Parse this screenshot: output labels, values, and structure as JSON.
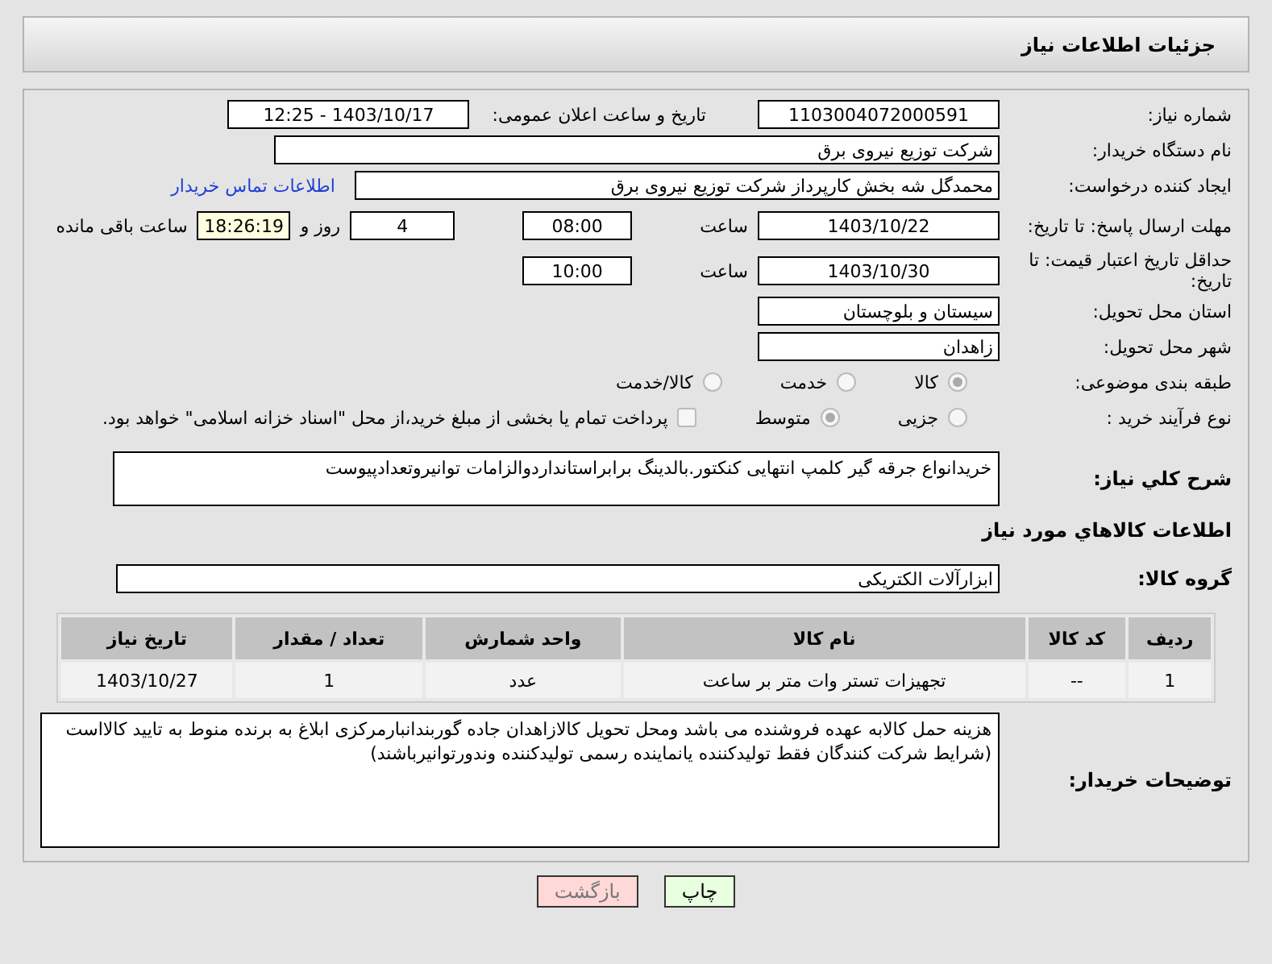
{
  "header": {
    "title": "جزئیات اطلاعات نیاز"
  },
  "need_number": {
    "label": "شماره نیاز:",
    "value": "1103004072000591"
  },
  "announce": {
    "label": "تاریخ و ساعت اعلان عمومی:",
    "value": "1403/10/17 - 12:25"
  },
  "buyer_org": {
    "label": "نام دستگاه خریدار:",
    "value": "شرکت توزیع نیروی برق"
  },
  "requester": {
    "label": "ایجاد کننده درخواست:",
    "value": "محمدگل شه بخش کارپرداز شرکت توزیع نیروی برق",
    "link": "اطلاعات تماس خریدار"
  },
  "reply_deadline": {
    "label": "مهلت ارسال پاسخ: تا تاریخ:",
    "date": "1403/10/22",
    "time_label": "ساعت",
    "time": "08:00",
    "days": "4",
    "days_label": "روز و",
    "remaining": "18:26:19",
    "remaining_label": "ساعت باقی مانده"
  },
  "price_validity": {
    "label": "حداقل تاریخ اعتبار قیمت: تا تاریخ:",
    "date": "1403/10/30",
    "time_label": "ساعت",
    "time": "10:00"
  },
  "province": {
    "label": "استان محل تحویل:",
    "value": "سیستان و بلوچستان"
  },
  "city": {
    "label": "شهر محل تحویل:",
    "value": "زاهدان"
  },
  "category": {
    "label": "طبقه بندی موضوعی:",
    "options": [
      {
        "label": "کالا",
        "selected": true
      },
      {
        "label": "خدمت",
        "selected": false
      },
      {
        "label": "کالا/خدمت",
        "selected": false
      }
    ]
  },
  "process": {
    "label": "نوع فرآیند خرید :",
    "options": [
      {
        "label": "جزیی",
        "selected": false
      },
      {
        "label": "متوسط",
        "selected": true
      }
    ],
    "payment": {
      "checked": false,
      "label": "پرداخت تمام یا بخشی از مبلغ خرید،از محل \"اسناد خزانه اسلامی\" خواهد بود."
    }
  },
  "description": {
    "label": "شرح کلي نياز:",
    "value": "خریدانواع جرقه گیر کلمپ انتهایی کنکتور.بالدینگ برابراستانداردوالزامات توانیروتعدادپیوست"
  },
  "goods_section": {
    "title": "اطلاعات کالاهاي مورد نياز"
  },
  "goods_group": {
    "label": "گروه کالا:",
    "value": "ابزارآلات الکتریکی"
  },
  "table": {
    "columns": [
      "ردیف",
      "کد کالا",
      "نام کالا",
      "واحد شمارش",
      "تعداد / مقدار",
      "تاریخ نیاز"
    ],
    "rows": [
      [
        "1",
        "--",
        "تجهیزات تستر وات متر بر ساعت",
        "عدد",
        "1",
        "1403/10/27"
      ]
    ]
  },
  "buyer_notes": {
    "label": "توضیحات خریدار:",
    "value": "هزینه حمل کالابه عهده فروشنده می باشد ومحل تحویل کالازاهدان جاده گوربندانبارمرکزی  ابلاغ به برنده منوط به تایید کالااست (شرایط شرکت کنندگان فقط تولیدکننده یانماینده رسمی تولیدکننده وندورتوانیرباشند)"
  },
  "buttons": [
    {
      "kind": "print",
      "label": "چاپ"
    },
    {
      "kind": "back",
      "label": "بازگشت"
    }
  ]
}
